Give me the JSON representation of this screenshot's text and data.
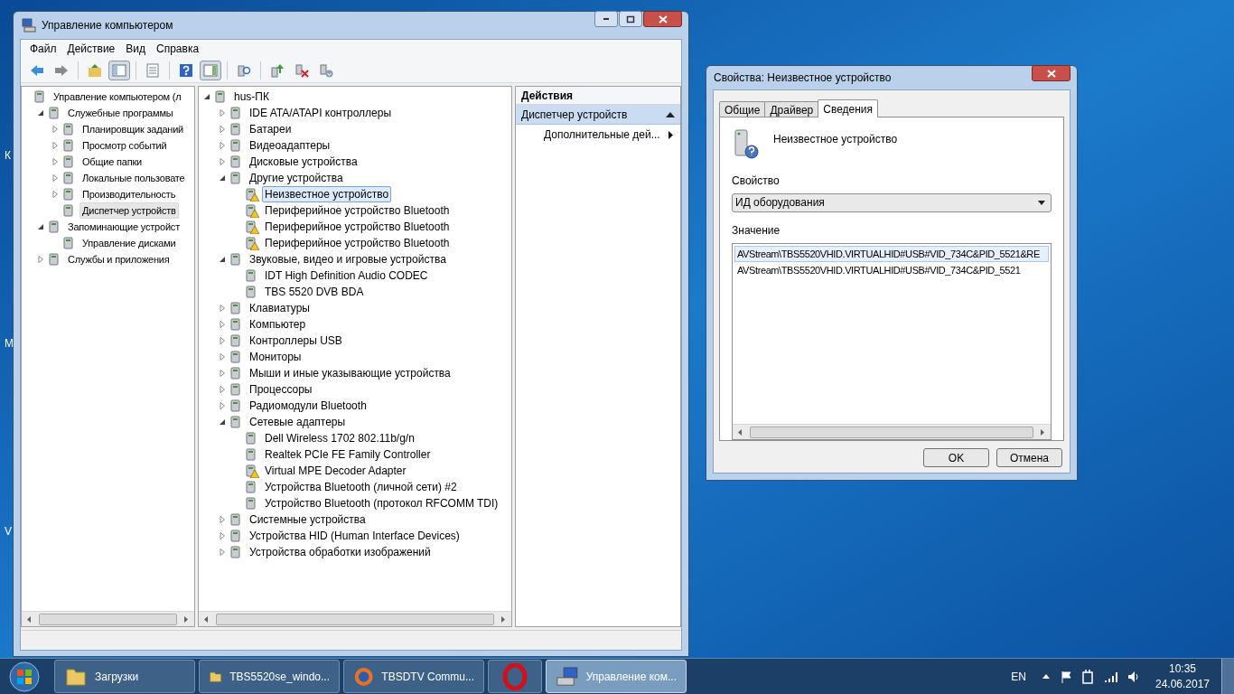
{
  "desktop_labels": [
    "К",
    "М",
    "V"
  ],
  "main_window": {
    "title": "Управление компьютером",
    "menu": [
      "Файл",
      "Действие",
      "Вид",
      "Справка"
    ],
    "toolbar": [
      [
        {
          "pressed": false
        },
        {
          "pressed": false
        }
      ],
      [
        {
          "pressed": false
        },
        {
          "pressed": true
        }
      ],
      [
        {
          "pressed": false
        }
      ],
      [
        {
          "pressed": false
        },
        {
          "pressed": true
        }
      ],
      [
        {
          "pressed": false
        }
      ],
      [
        {
          "pressed": false
        },
        {
          "pressed": false
        },
        {
          "pressed": false
        }
      ]
    ],
    "left_tree": {
      "focused": false,
      "nodes": [
        {
          "label": "Управление компьютером (л",
          "selected": false,
          "children": [
            {
              "label": "Служебные программы",
              "expanded": true,
              "selected": false,
              "children": [
                {
                  "label": "Планировщик заданий",
                  "expanded": false,
                  "selected": false
                },
                {
                  "label": "Просмотр событий",
                  "expanded": false,
                  "selected": false
                },
                {
                  "label": "Общие папки",
                  "expanded": false,
                  "selected": false
                },
                {
                  "label": "Локальные пользовате",
                  "expanded": false,
                  "selected": false
                },
                {
                  "label": "Производительность",
                  "expanded": false,
                  "selected": false
                },
                {
                  "label": "Диспетчер устройств",
                  "selected": true
                }
              ]
            },
            {
              "label": "Запоминающие устройст",
              "expanded": true,
              "selected": false,
              "children": [
                {
                  "label": "Управление дисками",
                  "selected": false
                }
              ]
            },
            {
              "label": "Службы и приложения",
              "expanded": false,
              "selected": false
            }
          ]
        }
      ]
    },
    "device_tree": {
      "focused": true,
      "nodes": [
        {
          "label": "hus-ПК",
          "expanded": true,
          "selected": false,
          "children": [
            {
              "label": "IDE ATA/ATAPI контроллеры",
              "expanded": false,
              "selected": false
            },
            {
              "label": "Батареи",
              "expanded": false,
              "selected": false
            },
            {
              "label": "Видеоадаптеры",
              "expanded": false,
              "selected": false
            },
            {
              "label": "Дисковые устройства",
              "expanded": false,
              "selected": false
            },
            {
              "label": "Другие устройства",
              "expanded": true,
              "selected": false,
              "children": [
                {
                  "label": "Неизвестное устройство",
                  "selected": true,
                  "warning": true
                },
                {
                  "label": "Периферийное устройство Bluetooth",
                  "selected": false,
                  "warning": true
                },
                {
                  "label": "Периферийное устройство Bluetooth",
                  "selected": false,
                  "warning": true
                },
                {
                  "label": "Периферийное устройство Bluetooth",
                  "selected": false,
                  "warning": true
                }
              ]
            },
            {
              "label": "Звуковые, видео и игровые устройства",
              "expanded": true,
              "selected": false,
              "children": [
                {
                  "label": "IDT High Definition Audio CODEC",
                  "selected": false
                },
                {
                  "label": "TBS 5520 DVB BDA",
                  "selected": false
                }
              ]
            },
            {
              "label": "Клавиатуры",
              "expanded": false,
              "selected": false
            },
            {
              "label": "Компьютер",
              "expanded": false,
              "selected": false
            },
            {
              "label": "Контроллеры USB",
              "expanded": false,
              "selected": false
            },
            {
              "label": "Мониторы",
              "expanded": false,
              "selected": false
            },
            {
              "label": "Мыши и иные указывающие устройства",
              "expanded": false,
              "selected": false
            },
            {
              "label": "Процессоры",
              "expanded": false,
              "selected": false
            },
            {
              "label": "Радиомодули Bluetooth",
              "expanded": false,
              "selected": false
            },
            {
              "label": "Сетевые адаптеры",
              "expanded": true,
              "selected": false,
              "children": [
                {
                  "label": "Dell Wireless 1702 802.11b/g/n",
                  "selected": false,
                  "warning": false
                },
                {
                  "label": "Realtek PCIe FE Family Controller",
                  "selected": false,
                  "warning": false
                },
                {
                  "label": "Virtual MPE Decoder Adapter",
                  "selected": false,
                  "warning": true
                },
                {
                  "label": "Устройства Bluetooth (личной сети) #2",
                  "selected": false,
                  "warning": false
                },
                {
                  "label": "Устройство Bluetooth (протокол RFCOMM TDI)",
                  "selected": false,
                  "warning": false
                }
              ]
            },
            {
              "label": "Системные устройства",
              "expanded": false,
              "selected": false
            },
            {
              "label": "Устройства HID (Human Interface Devices)",
              "expanded": false,
              "selected": false
            },
            {
              "label": "Устройства обработки изображений",
              "expanded": false,
              "selected": false
            }
          ]
        }
      ]
    },
    "actions": {
      "title": "Действия",
      "section": {
        "label": "Диспетчер устройств",
        "expanded": true
      },
      "items": [
        {
          "label": "Дополнительные дей...",
          "submenu": true
        }
      ]
    }
  },
  "dialog": {
    "title": "Свойства: Неизвестное устройство",
    "tabs": [
      {
        "label": "Общие",
        "selected": false
      },
      {
        "label": "Драйвер",
        "selected": false
      },
      {
        "label": "Сведения",
        "selected": true
      }
    ],
    "device_name": "Неизвестное устройство",
    "property_label": "Свойство",
    "property_value": "ИД оборудования",
    "value_label": "Значение",
    "values": [
      {
        "text": "AVStream\\TBS5520VHID.VIRTUALHID#USB#VID_734C&PID_5521&RE",
        "selected": true
      },
      {
        "text": "AVStream\\TBS5520VHID.VIRTUALHID#USB#VID_734C&PID_5521",
        "selected": false
      }
    ],
    "buttons": [
      "OK",
      "Отмена"
    ]
  },
  "taskbar": {
    "items": [
      {
        "label": "Загрузки",
        "kind": "folder",
        "active": false
      },
      {
        "label": "TBS5520se_windo...",
        "kind": "folder",
        "active": false
      },
      {
        "label": "TBSDTV Commu...",
        "kind": "browser",
        "active": false
      },
      {
        "kind": "ring",
        "active": false
      },
      {
        "label": "Управление ком...",
        "kind": "computer",
        "active": true
      }
    ],
    "language": "EN",
    "time": "10:35",
    "date": "24.06.2017"
  }
}
